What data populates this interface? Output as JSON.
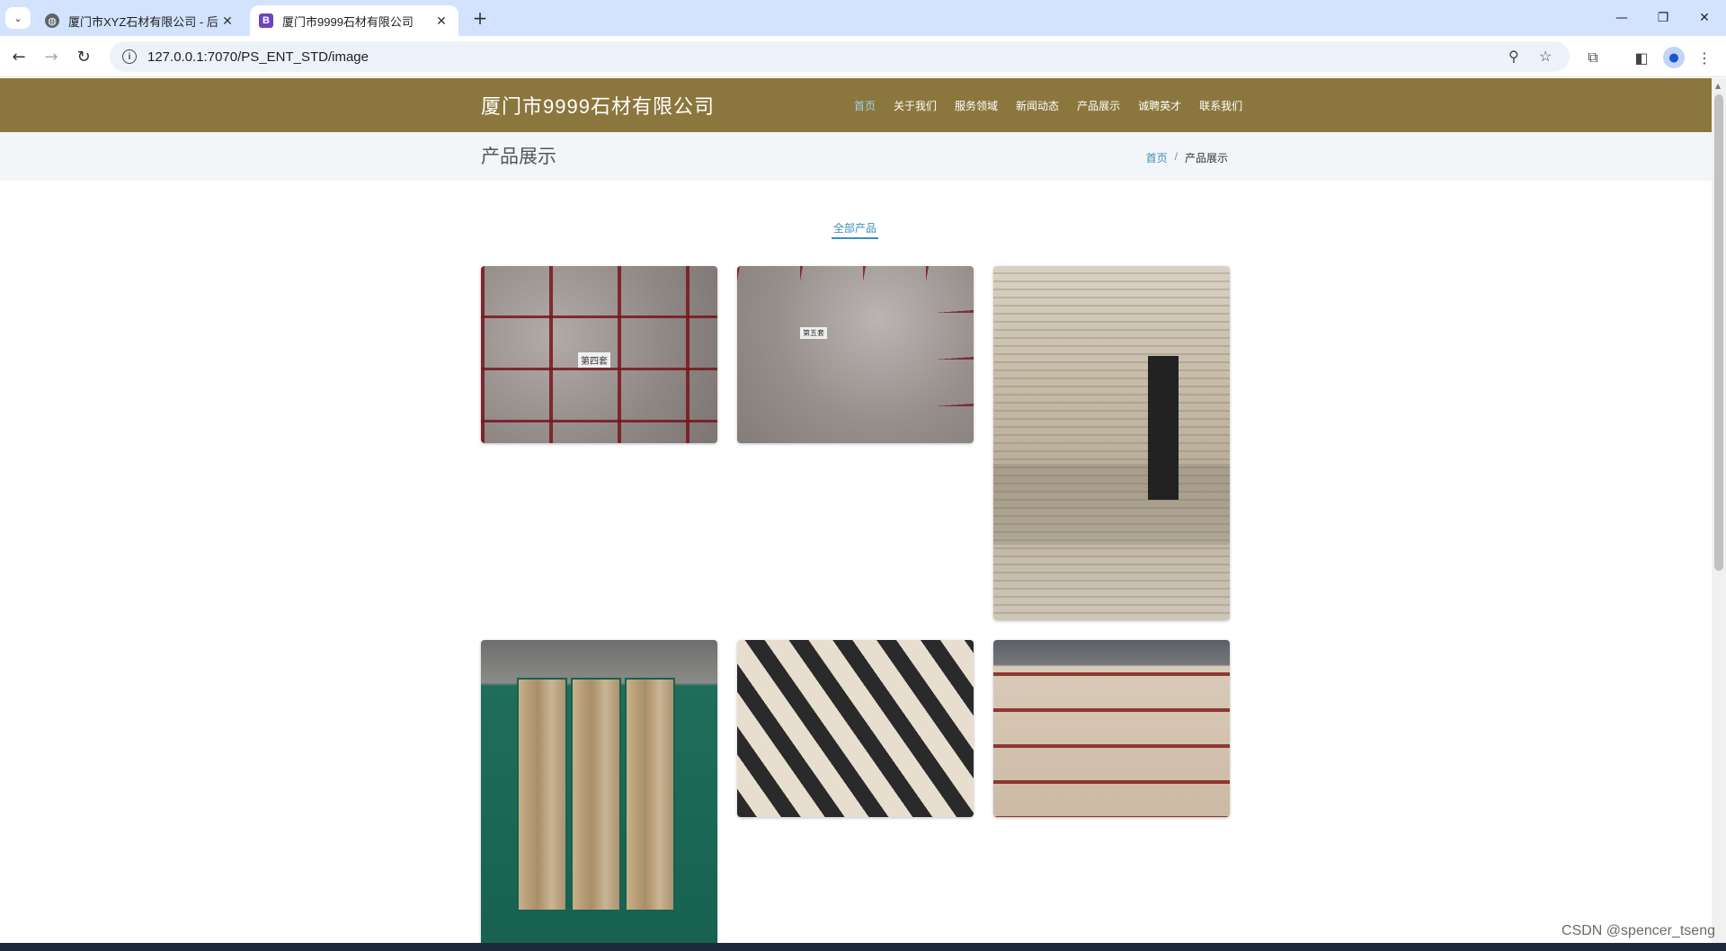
{
  "browser": {
    "tabs": [
      {
        "title": "厦门市XYZ石材有限公司 - 后台",
        "active": false
      },
      {
        "title": "厦门市9999石材有限公司",
        "active": true
      }
    ],
    "new_tab_label": "+",
    "url": "127.0.0.1:7070/PS_ENT_STD/image",
    "window_controls": {
      "minimize": "—",
      "restore": "❐",
      "close": "✕"
    }
  },
  "site": {
    "brand": "厦门市9999石材有限公司",
    "nav": [
      {
        "label": "首页",
        "active": true
      },
      {
        "label": "关于我们",
        "active": false
      },
      {
        "label": "服务领域",
        "active": false
      },
      {
        "label": "新闻动态",
        "active": false
      },
      {
        "label": "产品展示",
        "active": false
      },
      {
        "label": "诚聘英才",
        "active": false
      },
      {
        "label": "联系我们",
        "active": false
      }
    ],
    "colors": {
      "header": "#8b773e",
      "accent": "#3c8dbc"
    }
  },
  "page": {
    "title": "产品展示",
    "breadcrumb": {
      "home": "首页",
      "separator": "/",
      "current": "产品展示"
    },
    "filter_label": "全部产品",
    "gallery": [
      {
        "label": "第四套"
      },
      {
        "label": "第五套"
      },
      {
        "label": ""
      },
      {
        "label": ""
      },
      {
        "label": ""
      },
      {
        "label": ""
      }
    ]
  },
  "watermark": "CSDN @spencer_tseng"
}
